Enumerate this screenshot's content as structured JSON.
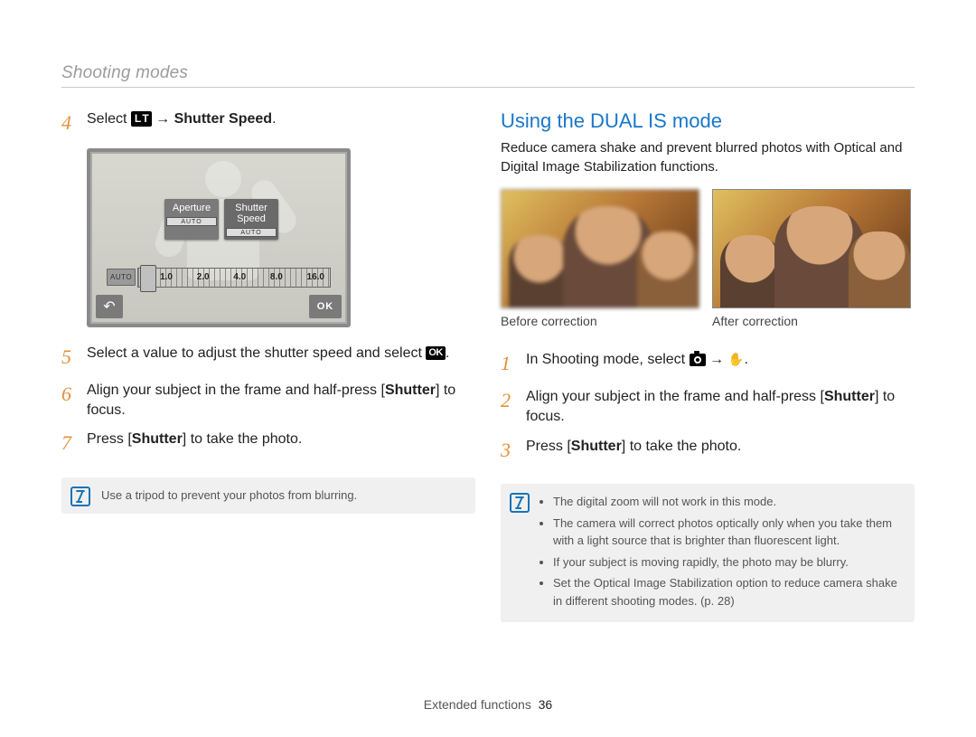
{
  "section_header": "Shooting modes",
  "left": {
    "steps": {
      "s4": {
        "num": "4",
        "prefix": "Select ",
        "icon_lt": "L T",
        "arrow": " → ",
        "bold": "Shutter Speed",
        "suffix": "."
      },
      "s5": {
        "num": "5",
        "text_a": "Select a value to adjust the shutter speed and select ",
        "ok": "OK",
        "text_b": "."
      },
      "s6": {
        "num": "6",
        "text_a": "Align your subject in the frame and half-press [",
        "bold": "Shutter",
        "text_b": "] to focus."
      },
      "s7": {
        "num": "7",
        "text_a": "Press [",
        "bold": "Shutter",
        "text_b": "] to take the photo."
      }
    },
    "lcd": {
      "aperture_label": "Aperture",
      "shutter_label_line1": "Shutter",
      "shutter_label_line2": "Speed",
      "auto_badge": "AUTO",
      "ticks": [
        "1.0",
        "2.0",
        "4.0",
        "8.0",
        "16.0"
      ],
      "back": "↶",
      "ok": "OK"
    },
    "note": "Use a tripod to prevent your photos from blurring."
  },
  "right": {
    "heading": "Using the DUAL IS mode",
    "intro": "Reduce camera shake and prevent blurred photos with Optical and Digital Image Stabilization functions.",
    "caption_before": "Before correction",
    "caption_after": "After correction",
    "steps": {
      "s1": {
        "num": "1",
        "text_a": "In Shooting mode, select ",
        "arrow": " → ",
        "text_b": "."
      },
      "s2": {
        "num": "2",
        "text_a": "Align your subject in the frame and half-press [",
        "bold": "Shutter",
        "text_b": "] to focus."
      },
      "s3": {
        "num": "3",
        "text_a": "Press [",
        "bold": "Shutter",
        "text_b": "] to take the photo."
      }
    },
    "notes": [
      "The digital zoom will not work in this mode.",
      "The camera will correct photos optically only when you take them with a light source that is brighter than fluorescent light.",
      "If your subject is moving rapidly, the photo may be blurry.",
      "Set the Optical Image Stabilization option to reduce camera shake in different shooting modes. (p. 28)"
    ]
  },
  "footer": {
    "label": "Extended functions",
    "page": "36"
  }
}
